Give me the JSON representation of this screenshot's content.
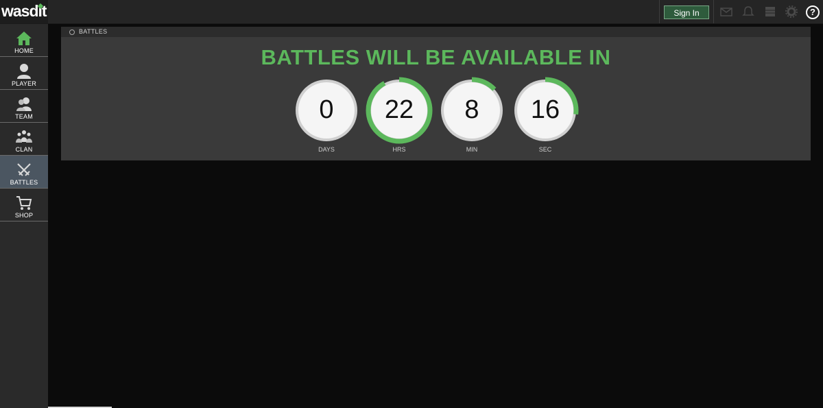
{
  "brand": {
    "logo_text": "wasdit",
    "accent": "#5cb85c"
  },
  "topbar": {
    "signin_label": "Sign In",
    "help_label": "?",
    "icons": [
      "mail-icon",
      "bell-icon",
      "grid-icon",
      "gear-icon",
      "help-icon"
    ]
  },
  "sidebar": {
    "items": [
      {
        "label": "HOME",
        "icon": "home-icon"
      },
      {
        "label": "PLAYER",
        "icon": "player-icon"
      },
      {
        "label": "TEAM",
        "icon": "team-icon"
      },
      {
        "label": "CLAN",
        "icon": "clan-icon"
      },
      {
        "label": "BATTLES",
        "icon": "swords-icon",
        "active": true
      },
      {
        "label": "SHOP",
        "icon": "cart-icon"
      }
    ]
  },
  "panel": {
    "breadcrumb": "BATTLES",
    "headline": "BATTLES WILL BE AVAILABLE IN"
  },
  "countdown": [
    {
      "value": "0",
      "label": "DAYS",
      "progress": 0.0
    },
    {
      "value": "22",
      "label": "HRS",
      "progress": 0.92
    },
    {
      "value": "8",
      "label": "MIN",
      "progress": 0.13
    },
    {
      "value": "16",
      "label": "SEC",
      "progress": 0.27
    }
  ]
}
